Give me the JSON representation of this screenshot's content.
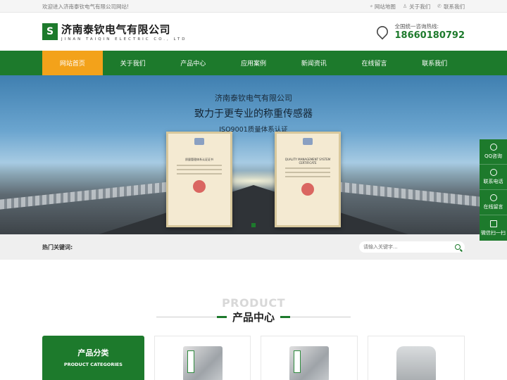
{
  "topbar": {
    "welcome": "欢迎进入济南泰钦电气有限公司网站!",
    "links": [
      "网站地图",
      "关于我们",
      "联系我们"
    ]
  },
  "header": {
    "logo_cn": "济南泰钦电气有限公司",
    "logo_en": "JINAN TAIQIN ELECTRIC CO., LTD",
    "hotline_label": "全国统一咨询热线:",
    "hotline_number": "18660180792"
  },
  "nav": {
    "items": [
      "网站首页",
      "关于我们",
      "产品中心",
      "应用案例",
      "新闻资讯",
      "在线留言",
      "联系我们"
    ],
    "active_index": 0
  },
  "banner": {
    "line1": "济南泰钦电气有限公司",
    "line2": "致力于更专业的称重传感器",
    "line3": "ISO9001质量体系认证",
    "cert_left_title": "质量管理体系认证证书",
    "cert_right_title": "QUALITY MANAGEMENT SYSTEM CERTIFICATE"
  },
  "search": {
    "hot_label": "热门关键词:",
    "placeholder": "请输入关键字..."
  },
  "products_section": {
    "title_en": "PRODUCT",
    "title_cn": "产品中心",
    "category_cn": "产品分类",
    "category_en": "PRODUCT CATEGORIES"
  },
  "float_bar": {
    "items": [
      "QQ咨询",
      "联系电话",
      "在线留言",
      "微信扫一扫"
    ]
  },
  "colors": {
    "brand_green": "#1d7a2c",
    "active_orange": "#f3a21a"
  }
}
